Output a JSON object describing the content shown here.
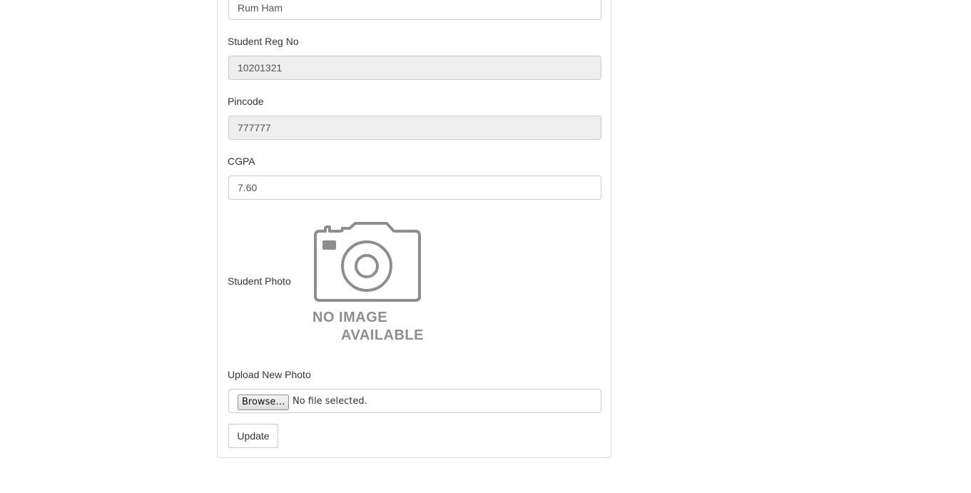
{
  "form": {
    "name_value": "Rum Ham",
    "reg_no_label": "Student Reg No",
    "reg_no_value": "10201321",
    "pincode_label": "Pincode",
    "pincode_value": "777777",
    "cgpa_label": "CGPA",
    "cgpa_value": "7.60",
    "photo_label": "Student Photo",
    "photo_placeholder_line1": "NO IMAGE",
    "photo_placeholder_line2": "AVAILABLE",
    "upload_label": "Upload New Photo",
    "browse_label": "Browse…",
    "file_status": "No file selected.",
    "update_label": "Update"
  },
  "colors": {
    "readonly_bg": "#eeeeee",
    "border": "#cccccc",
    "placeholder_gray": "#8e8e8e"
  }
}
